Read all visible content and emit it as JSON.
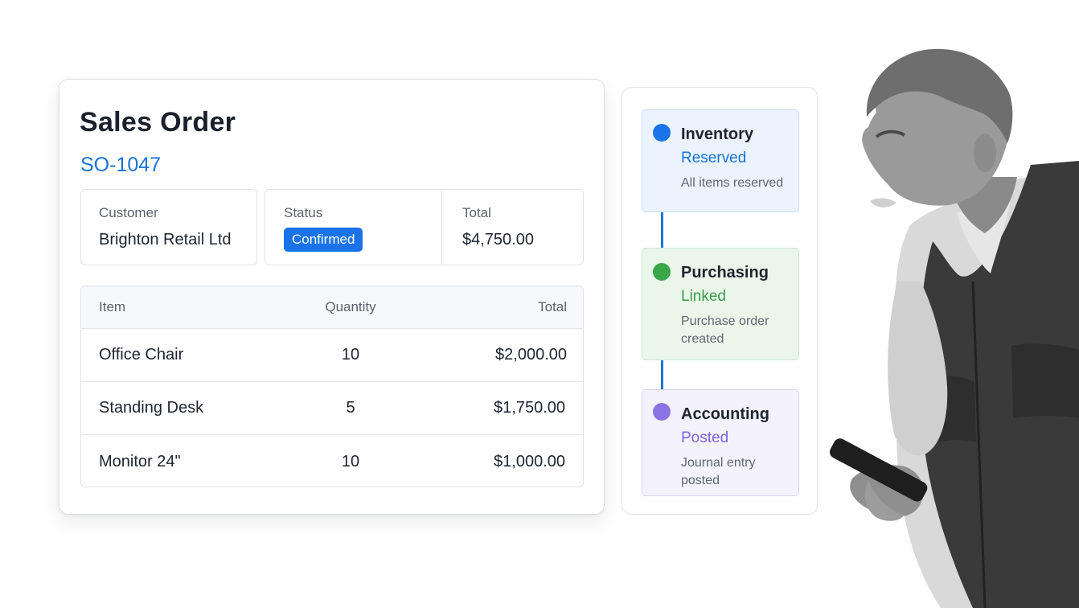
{
  "order": {
    "title": "Sales Order",
    "number": "SO-1047",
    "customer_label": "Customer",
    "customer_value": "Brighton Retail Ltd",
    "status_label": "Status",
    "status_value": "Confirmed",
    "total_label": "Total",
    "total_value": "$4,750.00"
  },
  "table": {
    "headers": {
      "item": "Item",
      "quantity": "Quantity",
      "total": "Total"
    },
    "rows": [
      {
        "item": "Office Chair",
        "quantity": "10",
        "total": "$2,000.00"
      },
      {
        "item": "Standing Desk",
        "quantity": "5",
        "total": "$1,750.00"
      },
      {
        "item": "Monitor 24\"",
        "quantity": "10",
        "total": "$1,000.00"
      }
    ]
  },
  "workflow": {
    "steps": [
      {
        "title": "Inventory",
        "status": "Reserved",
        "description": "All items reserved"
      },
      {
        "title": "Purchasing",
        "status": "Linked",
        "description": "Purchase order created"
      },
      {
        "title": "Accounting",
        "status": "Posted",
        "description": "Journal entry posted"
      }
    ]
  },
  "colors": {
    "accent_blue": "#1a73e8",
    "status_green": "#3a9a46",
    "status_purple": "#8062dd"
  }
}
